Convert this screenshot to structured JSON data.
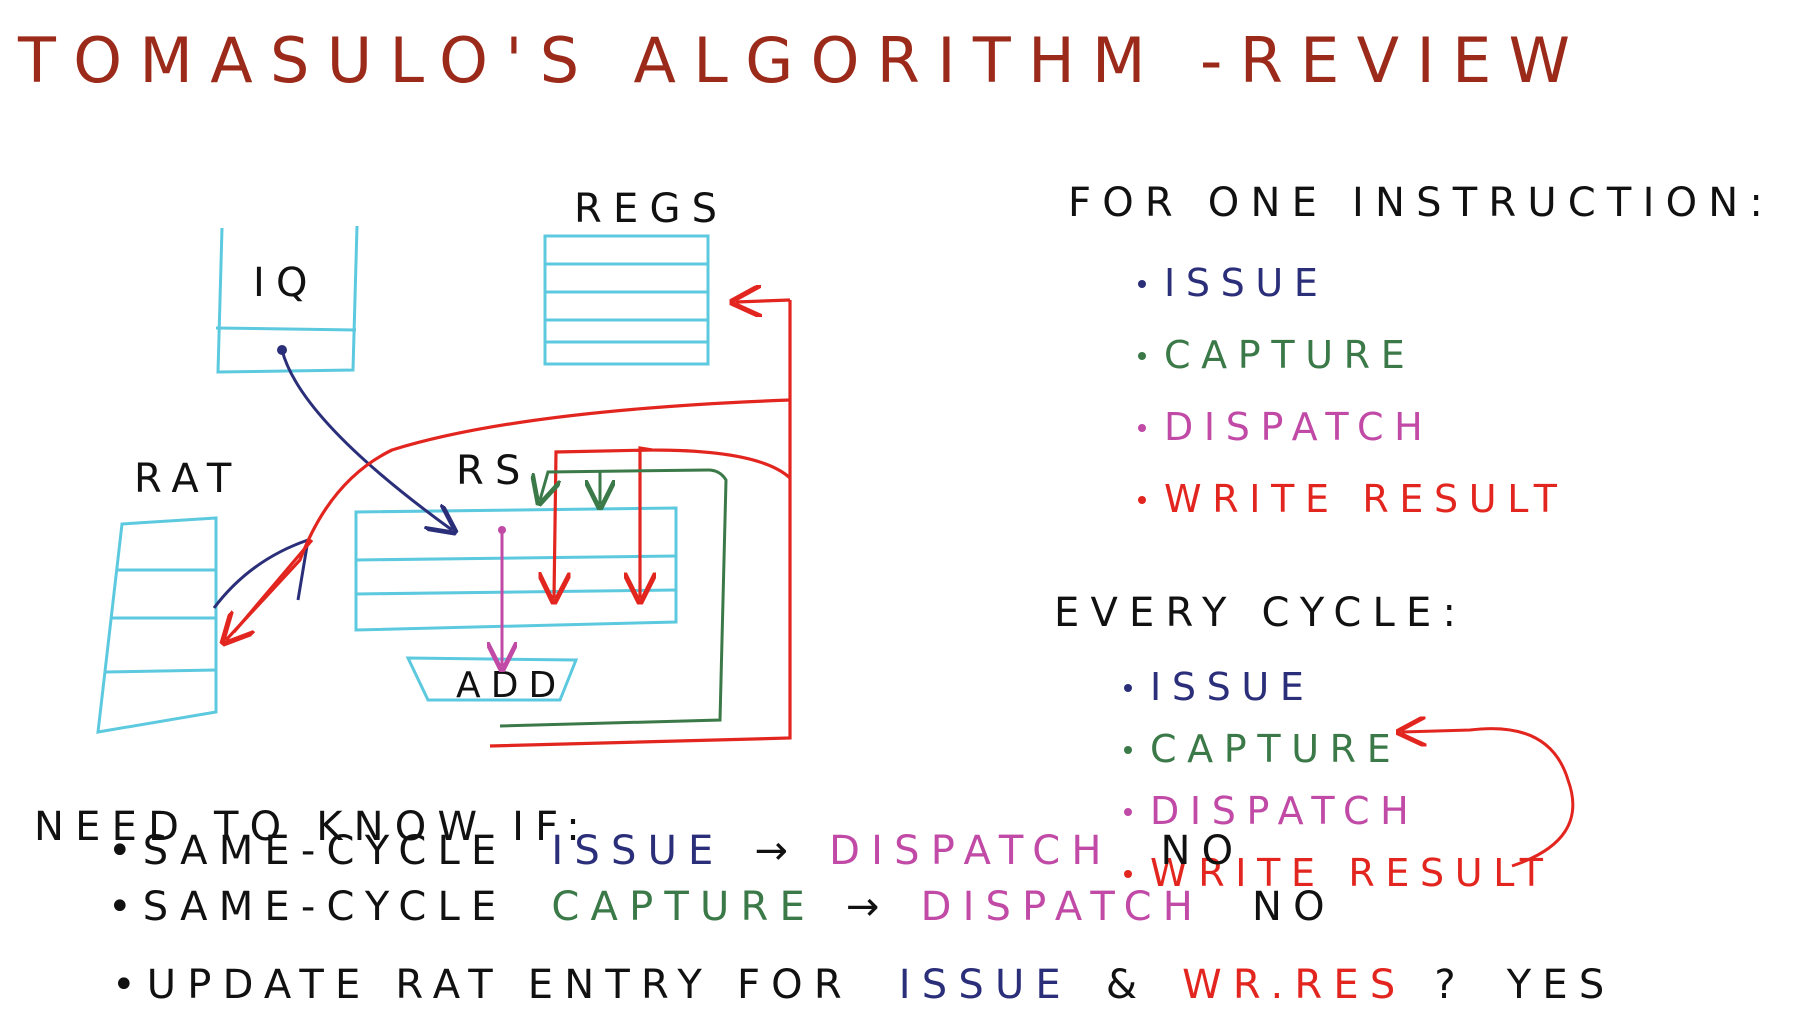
{
  "colors": {
    "title": "#9c2a1a",
    "ink": "#111111",
    "cyan": "#5cc9df",
    "navy": "#2b2f7a",
    "green": "#3b7a48",
    "magenta": "#c04aa6",
    "red": "#e2261f"
  },
  "title": "TOMASULO'S ALGORITHM -REVIEW",
  "diagram": {
    "iq_label": "IQ",
    "regs_label": "REGS",
    "rat_label": "RAT",
    "rs_label": "RS",
    "add_label": "ADD"
  },
  "one_instruction": {
    "heading": "FOR ONE INSTRUCTION:",
    "items": [
      {
        "text": "ISSUE",
        "color": "navy"
      },
      {
        "text": "CAPTURE",
        "color": "green"
      },
      {
        "text": "DISPATCH",
        "color": "magenta"
      },
      {
        "text": "WRITE RESULT",
        "color": "red"
      }
    ]
  },
  "every_cycle": {
    "heading": "EVERY CYCLE:",
    "items": [
      {
        "text": "ISSUE",
        "color": "navy"
      },
      {
        "text": "CAPTURE",
        "color": "green"
      },
      {
        "text": "DISPATCH",
        "color": "magenta"
      },
      {
        "text": "WRITE RESULT",
        "color": "red"
      }
    ]
  },
  "notes": {
    "heading": "NEED TO KNOW IF:",
    "q1": {
      "prefix": "•SAME-CYCLE",
      "a": "ISSUE",
      "arrow": "→",
      "b": "DISPATCH",
      "answer": "NO"
    },
    "q2": {
      "prefix": "•SAME-CYCLE",
      "a": "CAPTURE",
      "arrow": "→",
      "b": "DISPATCH",
      "answer": "NO"
    },
    "q3": {
      "prefix": "•UPDATE RAT ENTRY FOR",
      "a": "ISSUE",
      "amp": "&",
      "b": "WR.RES",
      "q": "?",
      "answer": "YES"
    }
  }
}
